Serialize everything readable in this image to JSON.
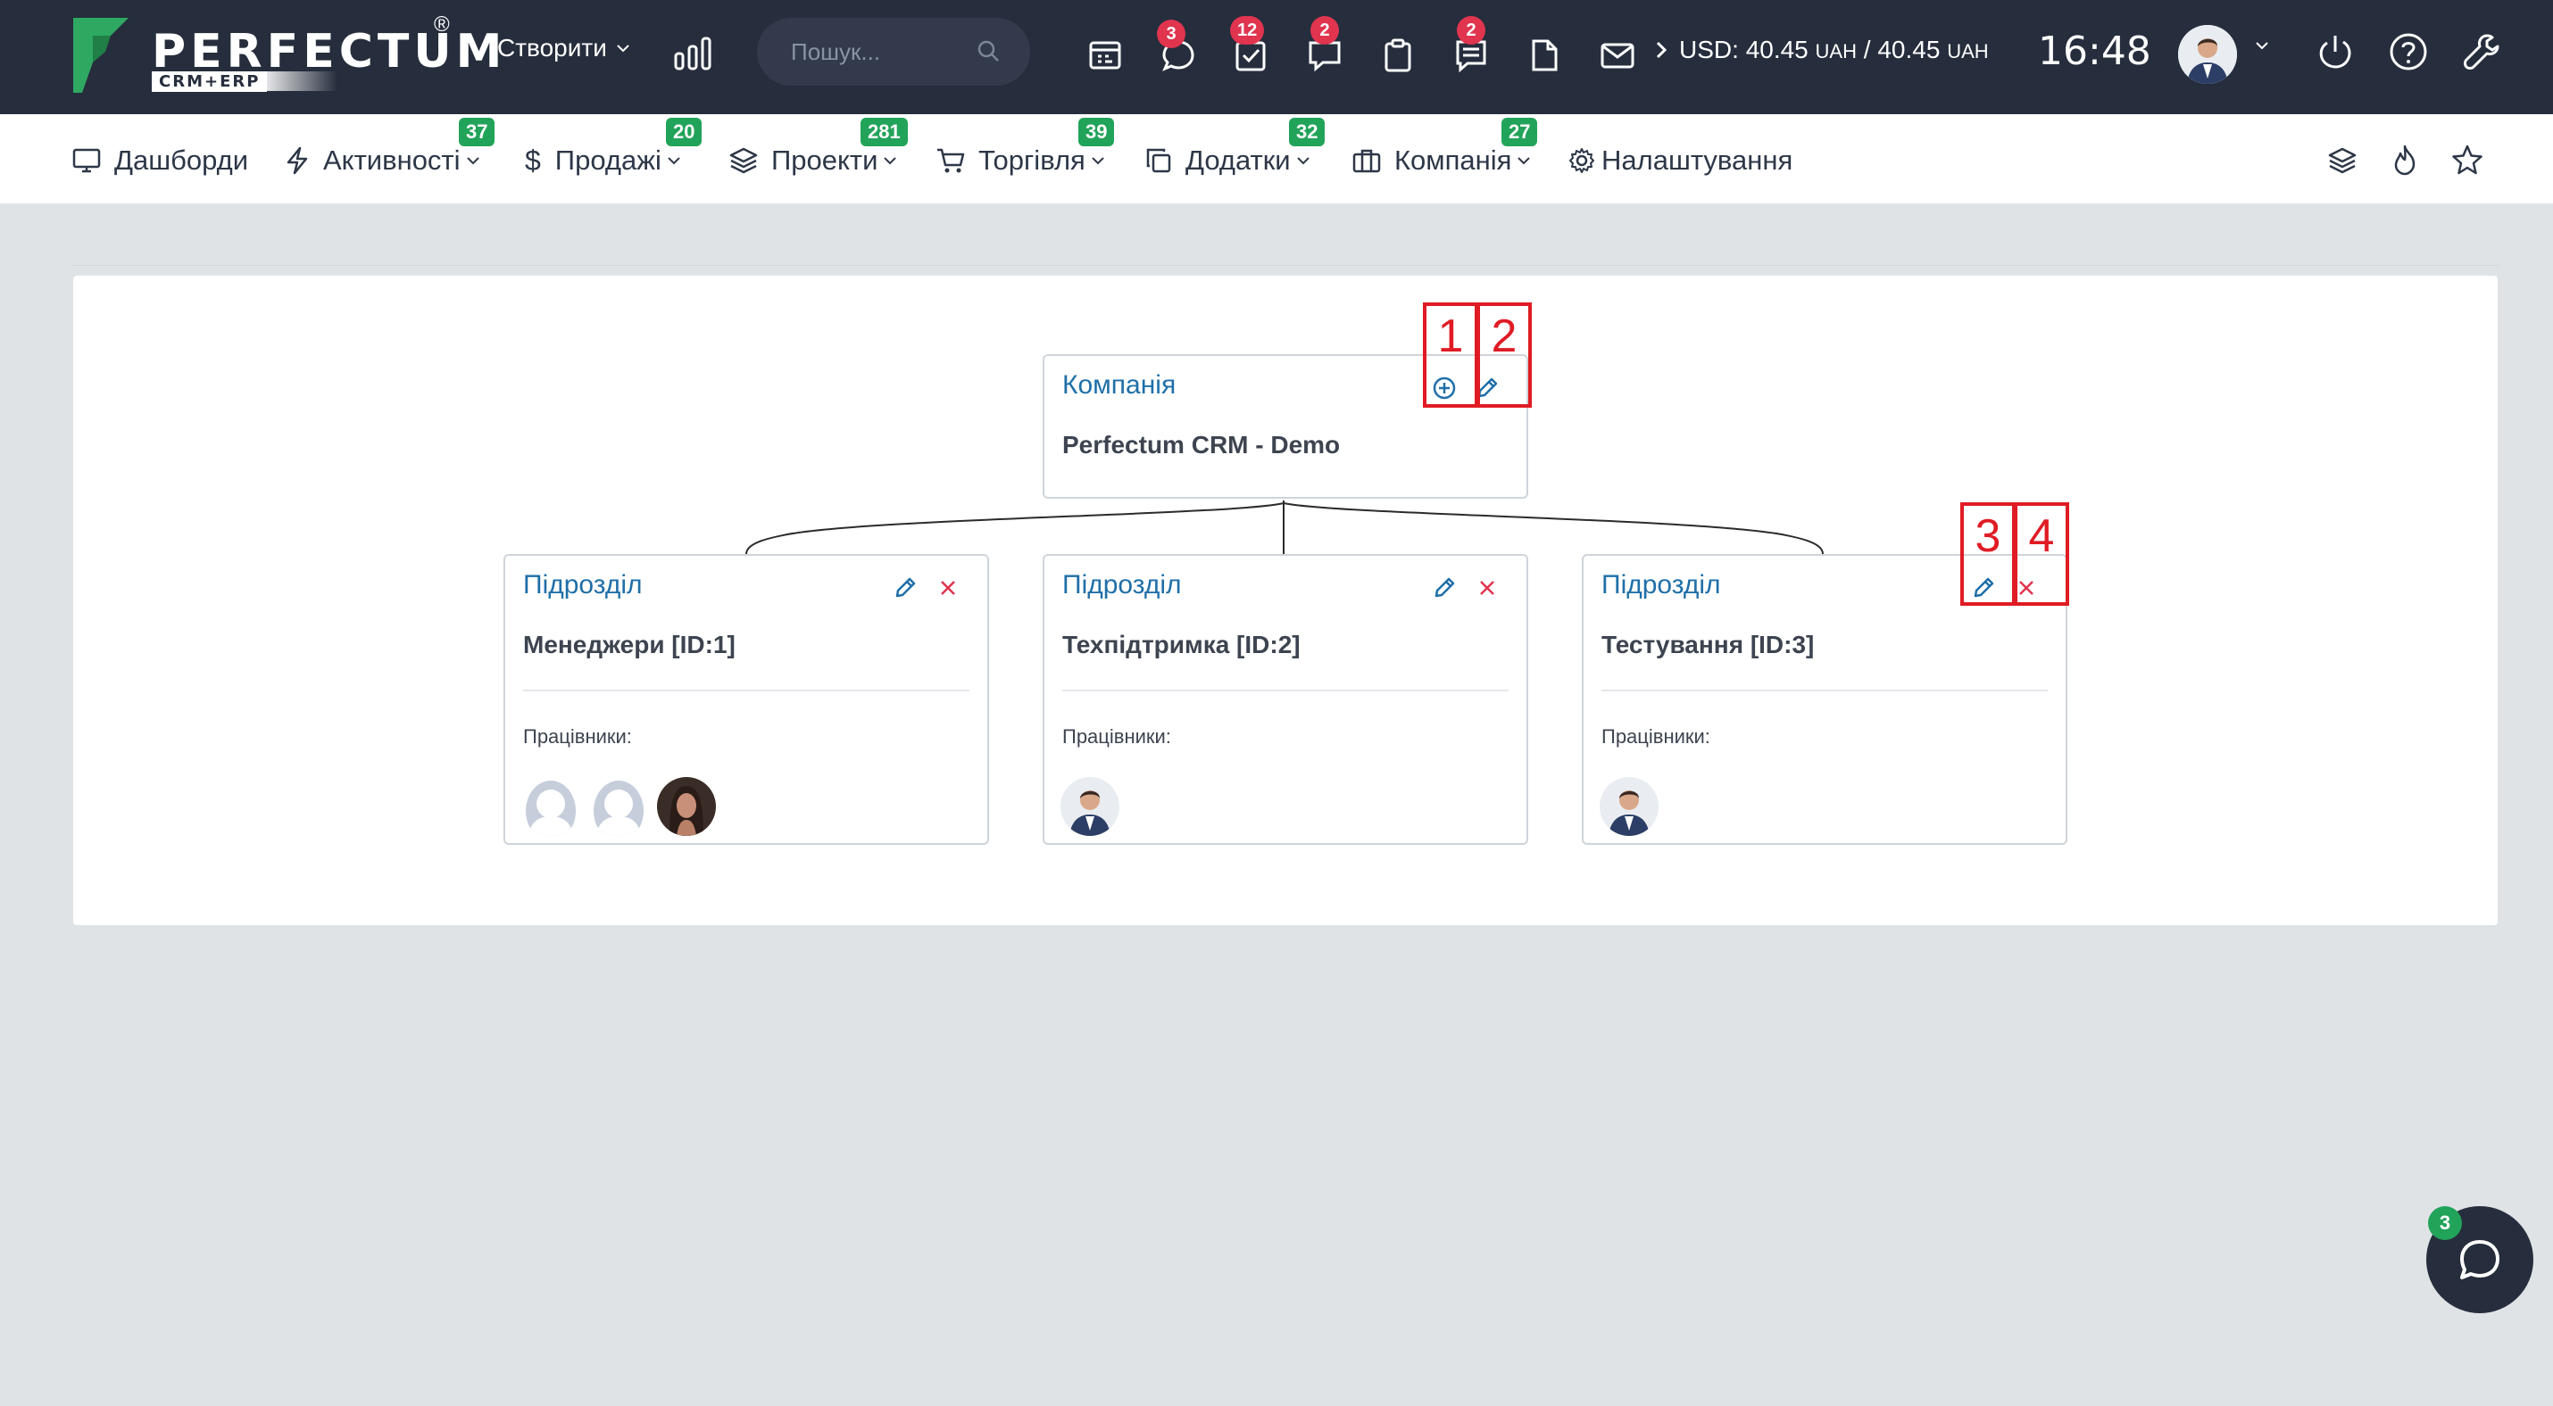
{
  "brand": {
    "name": "PERFECTUM",
    "reg": "®",
    "sub": "CRM+ERP"
  },
  "topbar": {
    "create_label": "Створити",
    "search_placeholder": "Пошук...",
    "notifications": {
      "messages": "3",
      "tasks": "12",
      "chats": "2",
      "notes": "2"
    },
    "currency": {
      "prefix": "USD:",
      "buy": "40.45",
      "sep": "/",
      "sell": "40.45",
      "unit": "UAH"
    },
    "time": "16:48"
  },
  "nav": {
    "dashboards": "Дашборди",
    "activities": {
      "label": "Активності",
      "count": "37"
    },
    "sales": {
      "label": "Продажі",
      "count": "20"
    },
    "projects": {
      "label": "Проекти",
      "count": "281"
    },
    "trade": {
      "label": "Торгівля",
      "count": "39"
    },
    "addons": {
      "label": "Додатки",
      "count": "32"
    },
    "company": {
      "label": "Компанія",
      "count": "27"
    },
    "settings": "Налаштування"
  },
  "org": {
    "root": {
      "type": "Компанія",
      "name": "Perfectum CRM - Demo"
    },
    "staff_label": "Працівники:",
    "departments": [
      {
        "type": "Підрозділ",
        "name": "Менеджери [ID:1]"
      },
      {
        "type": "Підрозділ",
        "name": "Техпідтримка [ID:2]"
      },
      {
        "type": "Підрозділ",
        "name": "Тестування [ID:3]"
      }
    ]
  },
  "annotations": {
    "n1": "1",
    "n2": "2",
    "n3": "3",
    "n4": "4"
  },
  "chat": {
    "badge": "3"
  },
  "colors": {
    "topbar_bg": "#262d3c",
    "accent_blue": "#1f6fa8",
    "badge_red": "#e0344f",
    "badge_green": "#22a35a",
    "annotation_red": "#e01b24"
  }
}
